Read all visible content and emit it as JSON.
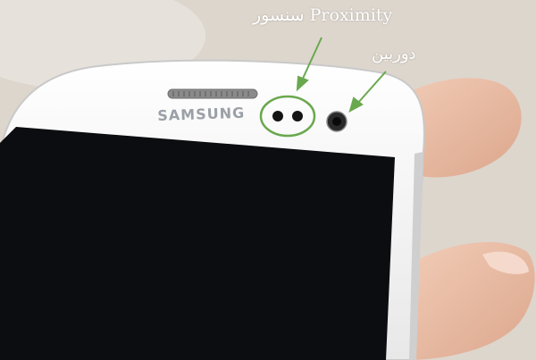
{
  "annotations": {
    "proximity_label": "سنسور Proximity",
    "camera_label": "دوربین",
    "highlight_color": "#6aa84f"
  },
  "device": {
    "brand": "SAMSUNG",
    "body_color": "#f4f4f4",
    "screen_color": "#0c0d10"
  }
}
